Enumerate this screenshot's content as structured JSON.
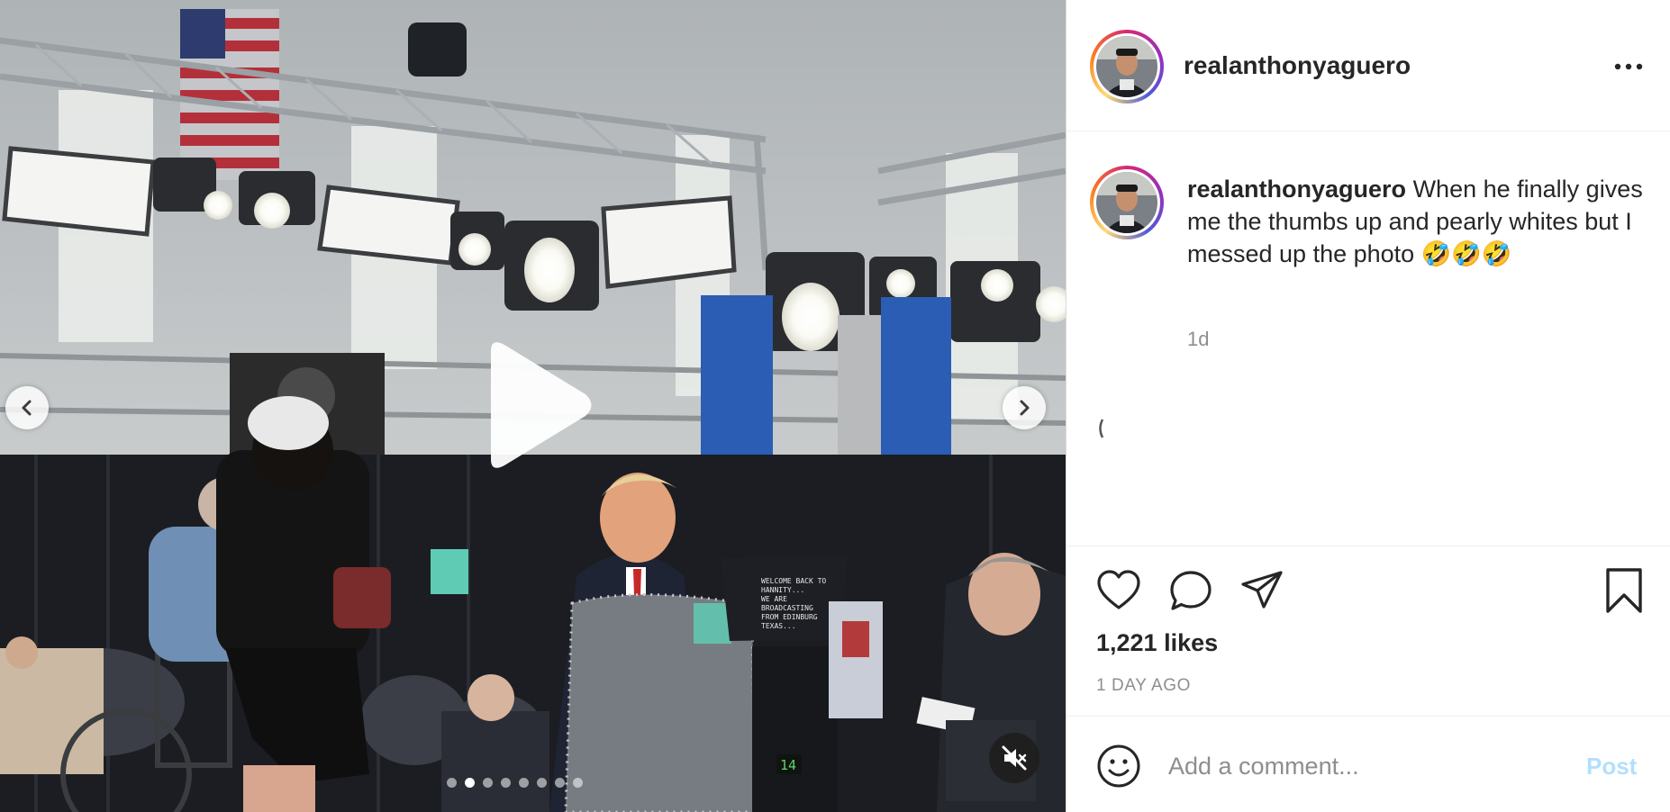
{
  "post": {
    "username": "realanthonyaguero",
    "caption": "When he finally gives me the thumbs up and pearly whites but I messed up the photo 🤣🤣🤣",
    "time_ago": "1d",
    "likes": "1,221 likes",
    "date": "1 DAY AGO"
  },
  "media": {
    "teleprompter_text": [
      "WELCOME BACK TO",
      "HANNITY...",
      "WE ARE",
      "BROADCASTING",
      "FROM EDINBURG",
      "TEXAS..."
    ],
    "counter": "14",
    "slide_count": 8,
    "active_slide": 1
  },
  "comment_box": {
    "placeholder": "Add a comment...",
    "post_label": "Post"
  },
  "icons": {
    "more": "more-options-icon",
    "like": "heart-icon",
    "comment": "comment-bubble-icon",
    "share": "paper-plane-icon",
    "save": "bookmark-icon",
    "emoji": "smiley-icon",
    "mute": "speaker-muted-icon",
    "prev": "chevron-left-icon",
    "next": "chevron-right-icon",
    "play": "play-icon"
  },
  "colors": {
    "accent_disabled": "#b2dffc",
    "secondary_text": "#8e8e8e",
    "primary_text": "#262626"
  }
}
